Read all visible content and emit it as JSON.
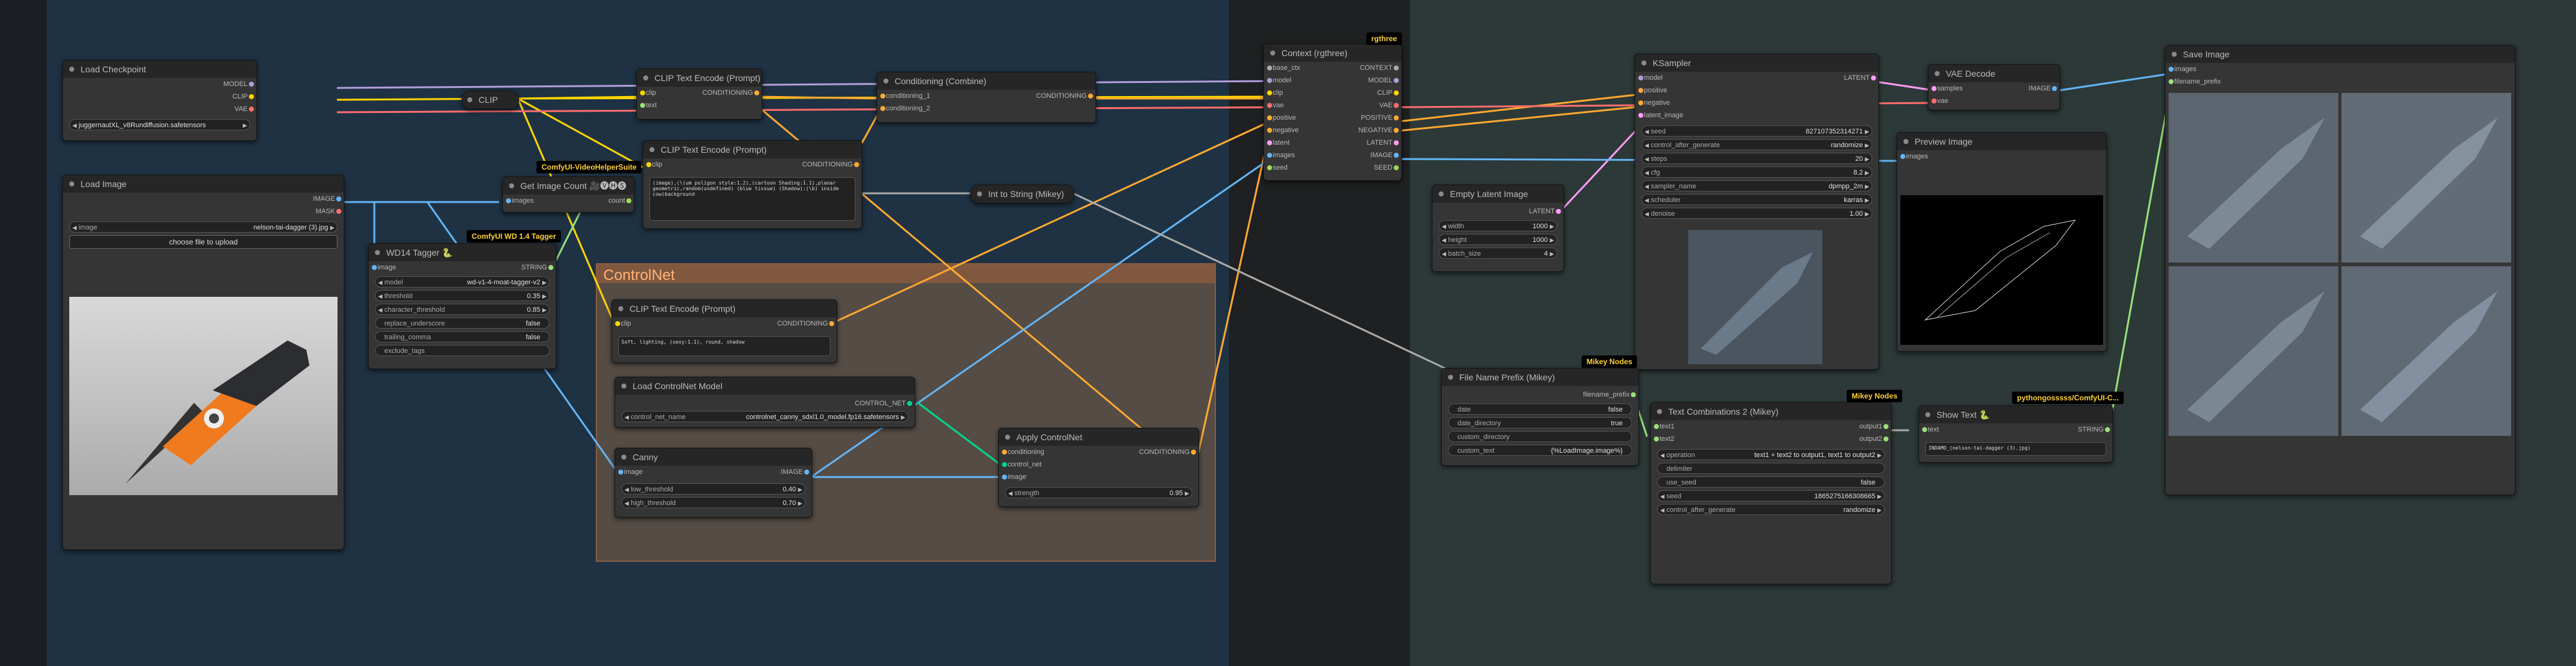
{
  "nodes": {
    "load_checkpoint": {
      "title": "Load Checkpoint",
      "outputs": [
        "MODEL",
        "CLIP",
        "VAE"
      ],
      "ckpt_name": "juggernautXL_v8Rundiffusion.safetensors"
    },
    "load_image": {
      "title": "Load Image",
      "outputs": [
        "IMAGE",
        "MASK"
      ],
      "image_label": "image",
      "image_value": "nelson-tai-dagger (3).jpg",
      "upload": "choose file to upload"
    },
    "clip_node": {
      "label": "CLIP"
    },
    "get_image_count": {
      "title": "Get Image Count 🎥🅥🅗🅢",
      "input": "images",
      "output": "count"
    },
    "wd14": {
      "title": "WD14 Tagger 🐍",
      "input": "image",
      "output": "STRING",
      "widgets": [
        {
          "label": "model",
          "value": "wd-v1-4-moat-tagger-v2"
        },
        {
          "label": "threshold",
          "value": "0.35"
        },
        {
          "label": "character_threshold",
          "value": "0.85"
        },
        {
          "label": "replace_underscore",
          "value": "false"
        },
        {
          "label": "trailing_comma",
          "value": "false"
        },
        {
          "label": "exclude_tags",
          "value": ""
        }
      ]
    },
    "clip_text_1": {
      "title": "CLIP Text Encode (Prompt)",
      "inputs": [
        "clip",
        "text"
      ],
      "output": "CONDITIONING"
    },
    "clip_text_2": {
      "title": "CLIP Text Encode (Prompt)",
      "inputs": [
        "clip"
      ],
      "output": "CONDITIONING",
      "text": "(image),(\\(um poligon style:1.2),(cartoon Shading:1.1),planar\ngeometric,random(undefined) (blue tissue) (Shadow):(\\b) inside\ncow(background"
    },
    "cond_combine": {
      "title": "Conditioning (Combine)",
      "inputs": [
        "conditioning_1",
        "conditioning_2"
      ],
      "output": "CONDITIONING"
    },
    "int_to_string": {
      "title": "Int to String (Mikey)"
    },
    "clip_text_3": {
      "title": "CLIP Text Encode (Prompt)",
      "inputs": [
        "clip"
      ],
      "output": "CONDITIONING",
      "text": "Soft, lighting, (sexy:1.1), round, shadow"
    },
    "load_controlnet": {
      "title": "Load ControlNet Model",
      "output": "CONTROL_NET",
      "widget_label": "control_net_name",
      "widget_value": "controlnet_canny_sdxl1.0_model.fp16.safetensors"
    },
    "canny": {
      "title": "Canny",
      "input": "image",
      "output": "IMAGE",
      "widgets": [
        {
          "label": "low_threshold",
          "value": "0.40"
        },
        {
          "label": "high_threshold",
          "value": "0.70"
        }
      ]
    },
    "apply_controlnet": {
      "title": "Apply ControlNet",
      "inputs": [
        "conditioning",
        "control_net",
        "image"
      ],
      "output": "CONDITIONING",
      "widget_label": "strength",
      "widget_value": "0.95"
    },
    "context": {
      "title": "Context (rgthree)",
      "inputs": [
        "base_ctx",
        "model",
        "clip",
        "vae",
        "positive",
        "negative",
        "latent",
        "images",
        "seed"
      ],
      "outputs": [
        "CONTEXT",
        "MODEL",
        "CLIP",
        "VAE",
        "POSITIVE",
        "NEGATIVE",
        "LATENT",
        "IMAGE",
        "SEED"
      ]
    },
    "empty_latent": {
      "title": "Empty Latent Image",
      "output": "LATENT",
      "widgets": [
        {
          "label": "width",
          "value": "1000"
        },
        {
          "label": "height",
          "value": "1000"
        },
        {
          "label": "batch_size",
          "value": "4"
        }
      ]
    },
    "ksampler": {
      "title": "KSampler",
      "inputs": [
        "model",
        "positive",
        "negative",
        "latent_image"
      ],
      "output": "LATENT",
      "widgets": [
        {
          "label": "seed",
          "value": "827107352314271"
        },
        {
          "label": "control_after_generate",
          "value": "randomize"
        },
        {
          "label": "steps",
          "value": "20"
        },
        {
          "label": "cfg",
          "value": "8.2"
        },
        {
          "label": "sampler_name",
          "value": "dpmpp_2m"
        },
        {
          "label": "scheduler",
          "value": "karras"
        },
        {
          "label": "denoise",
          "value": "1.00"
        }
      ]
    },
    "vae_decode": {
      "title": "VAE Decode",
      "inputs": [
        "samples",
        "vae"
      ],
      "output": "IMAGE"
    },
    "preview_image": {
      "title": "Preview Image",
      "input": "images"
    },
    "save_image": {
      "title": "Save Image",
      "inputs": [
        "images",
        "filename_prefix"
      ]
    },
    "file_name_prefix": {
      "title": "File Name Prefix (Mikey)",
      "output": "filename_prefix",
      "widgets": [
        {
          "label": "date",
          "value": "false"
        },
        {
          "label": "date_directory",
          "value": "true"
        },
        {
          "label": "custom_directory",
          "value": ""
        },
        {
          "label": "custom_text",
          "value": "{%LoadImage.image%}"
        }
      ]
    },
    "text_combinations": {
      "title": "Text Combinations 2 (Mikey)",
      "inputs": [
        "text1",
        "text2"
      ],
      "outputs": [
        "output1",
        "output2"
      ],
      "widgets": [
        {
          "label": "operation",
          "value": "text1 + text2 to output1, text1 to output2"
        },
        {
          "label": "delimiter",
          "value": ""
        },
        {
          "label": "use_seed",
          "value": "false"
        },
        {
          "label": "seed",
          "value": "1865275166308665"
        },
        {
          "label": "control_after_generate",
          "value": "randomize"
        }
      ]
    },
    "show_text": {
      "title": "Show Text 🐍",
      "input": "text",
      "output": "STRING",
      "text": "INDAMO_(nelson-tai-dagger (3).jpg)"
    }
  },
  "tags": {
    "rgthree": "rgthree",
    "videohelper": "ComfyUI-VideoHelperSuite",
    "wd14tagger": "ComfyUI WD 1.4 Tagger",
    "mikey1": "Mikey Nodes",
    "mikey2": "Mikey Nodes",
    "pysssss": "pythongosssss/ComfyUI-C..."
  },
  "group": {
    "title": "ControlNet"
  },
  "colors": {
    "model": "#b39ddb",
    "clip": "#ffd500",
    "vae": "#ff6e6e",
    "conditioning": "#ffa931",
    "latent": "#ff9cf9",
    "image": "#64b5f6",
    "string": "#9be07a",
    "control_net": "#00d78d"
  }
}
